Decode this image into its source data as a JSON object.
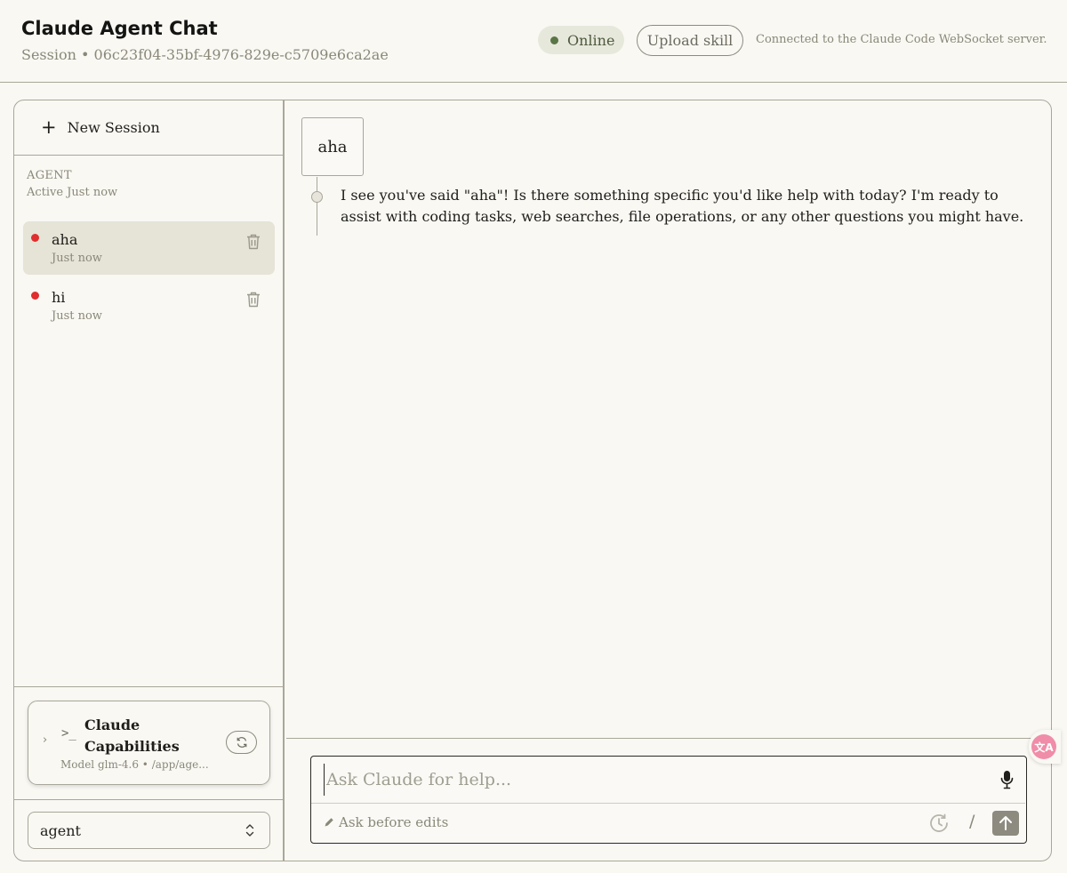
{
  "header": {
    "title": "Claude Agent Chat",
    "session": "Session • 06c23f04-35bf-4976-829e-c5709e6ca2ae",
    "status": "Online",
    "status_color": "#5b7646",
    "upload_label": "Upload skill",
    "connection_text": "Connected to the Claude Code WebSocket server."
  },
  "sidebar": {
    "new_session_label": "New Session",
    "agent_heading": "AGENT",
    "agent_active": "Active Just now",
    "sessions": [
      {
        "title": "aha",
        "time": "Just now",
        "selected": true,
        "status_color": "#e02d2d",
        "icon": "trash-icon"
      },
      {
        "title": "hi",
        "time": "Just now",
        "selected": false,
        "status_color": "#e02d2d",
        "icon": "trash-icon"
      }
    ],
    "capabilities": {
      "title": "Claude Capabilities",
      "meta": "Model glm-4.6 • /app/age...",
      "icons": [
        "chevron-right-icon",
        "terminal-icon",
        "refresh-icon"
      ]
    },
    "agent_select": {
      "value": "agent"
    }
  },
  "chat": {
    "messages": [
      {
        "role": "user",
        "text": "aha"
      },
      {
        "role": "assistant",
        "text": "I see you've said \"aha\"! Is there something specific you'd like help with today? I'm ready to assist with coding tasks, web searches, file operations, or any other questions you might have."
      }
    ],
    "composer": {
      "placeholder": "Ask Claude for help...",
      "value": "",
      "mode_label": "Ask before edits",
      "slash": "/",
      "icons": [
        "mic-icon",
        "pencil-icon",
        "history-icon",
        "arrow-up-icon"
      ]
    }
  },
  "translate_widget": {
    "label": "文A",
    "color": "#f08da8"
  }
}
